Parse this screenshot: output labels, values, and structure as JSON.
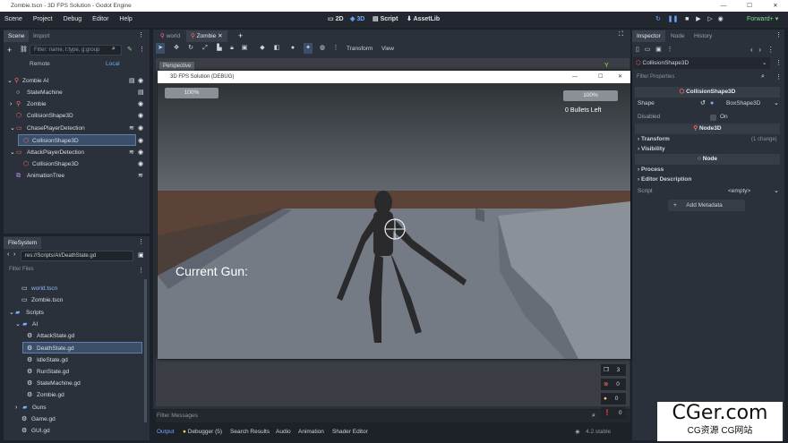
{
  "window": {
    "title": "Zombie.tscn - 3D FPS Solution - Godot Engine"
  },
  "menu": [
    "Scene",
    "Project",
    "Debug",
    "Editor",
    "Help"
  ],
  "main_buttons": {
    "b2d": "2D",
    "b3d": "3D",
    "script": "Script",
    "assetlib": "AssetLib"
  },
  "renderer": "Forward+",
  "scene_dock": {
    "tabs": [
      "Scene",
      "Import"
    ],
    "filter_placeholder": "Filter: name, t:type, g:group",
    "remote": "Remote",
    "local": "Local",
    "nodes": [
      "Zombie AI",
      "StateMachine",
      "Zombie",
      "CollisionShape3D",
      "ChasePlayerDetection",
      "CollisionShape3D",
      "AttackPlayerDetection",
      "CollisionShape3D",
      "AnimationTree"
    ]
  },
  "filesystem": {
    "title": "FileSystem",
    "path": "res://Scripts/AI/DeathState.gd",
    "filter_placeholder": "Filter Files",
    "items": [
      "world.tscn",
      "Zombie.tscn",
      "Scripts",
      "AI",
      "AttackState.gd",
      "DeathState.gd",
      "IdleState.gd",
      "RunState.gd",
      "StateMachine.gd",
      "Zombie.gd",
      "Guns",
      "Game.gd",
      "GUI.gd"
    ]
  },
  "editor_tabs": [
    "world",
    "Zombie"
  ],
  "toolbar": {
    "transform": "Transform",
    "view": "View"
  },
  "viewport": {
    "perspective_label": "Perspective"
  },
  "game_window": {
    "title": "3D FPS Solution (DEBUG)",
    "health_left": "100%",
    "health_right": "100%",
    "bullets": "0 Bullets Left",
    "current_gun": "Current Gun:"
  },
  "bottom": {
    "filter_messages": "Filter Messages",
    "tabs": [
      "Output",
      "Debugger (5)",
      "Search Results",
      "Audio",
      "Animation",
      "Shader Editor"
    ],
    "version": "4.2.stable",
    "counters": [
      "3",
      "0",
      "0",
      "0"
    ]
  },
  "inspector": {
    "tabs": [
      "Inspector",
      "Node",
      "History"
    ],
    "node_name": "CollisionShape3D",
    "filter_placeholder": "Filter Properties",
    "header": "CollisionShape3D",
    "shape_label": "Shape",
    "shape_value": "BoxShape3D",
    "disabled_label": "Disabled",
    "disabled_value": "On",
    "node3d_section": "Node3D",
    "transform": "Transform",
    "change_count": "(1 change)",
    "visibility": "Visibility",
    "node_section": "Node",
    "process": "Process",
    "editor_description": "Editor Description",
    "script_label": "Script",
    "script_value": "<empty>",
    "add_metadata": "Add Metadata"
  },
  "watermark": {
    "main": "CGer.com",
    "sub": "CG资源 CG网站"
  },
  "colors": {
    "accent": "#6fa7ff",
    "node3d_red": "#ff6b6b",
    "selection": "#3c4f6a"
  }
}
